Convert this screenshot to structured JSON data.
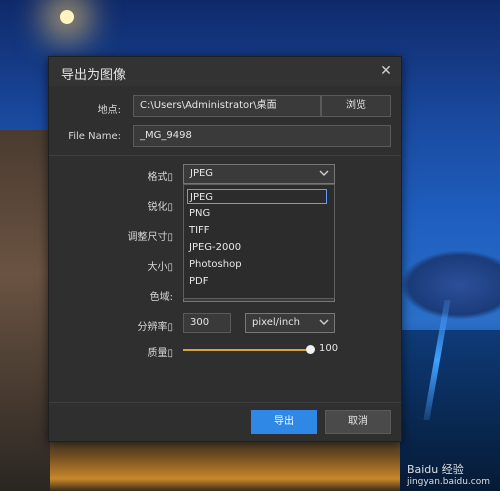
{
  "dialog": {
    "title": "导出为图像",
    "close_glyph": "✕",
    "location_label": "地点:",
    "location_value": "C:\\Users\\Administrator\\桌面",
    "browse_label": "浏览",
    "filename_label": "File Name:",
    "filename_value": "_MG_9498",
    "format_label": "格式▯",
    "format_value": "JPEG",
    "sharpen_label": "锐化▯",
    "resize_label": "调整尺寸▯",
    "size_label": "大小▯",
    "color_label": "色域:",
    "resolution_label": "分辨率▯",
    "resolution_value": "300",
    "resolution_unit": "pixel/inch",
    "quality_label": "质量▯",
    "quality_value": "100",
    "quality_fraction": 1.0,
    "export_label": "导出",
    "cancel_label": "取消"
  },
  "format_options": [
    "JPEG",
    "PNG",
    "TIFF",
    "JPEG-2000",
    "Photoshop",
    "PDF"
  ],
  "watermark": {
    "main": "Baidu 经验",
    "sub": "jingyan.baidu.com"
  },
  "icons": {
    "close": "close-icon",
    "chevron": "chevron-down-icon"
  },
  "colors": {
    "accent": "#2f88e6",
    "slider": "#d6a23a",
    "dialog_bg": "#2f2f2f"
  }
}
